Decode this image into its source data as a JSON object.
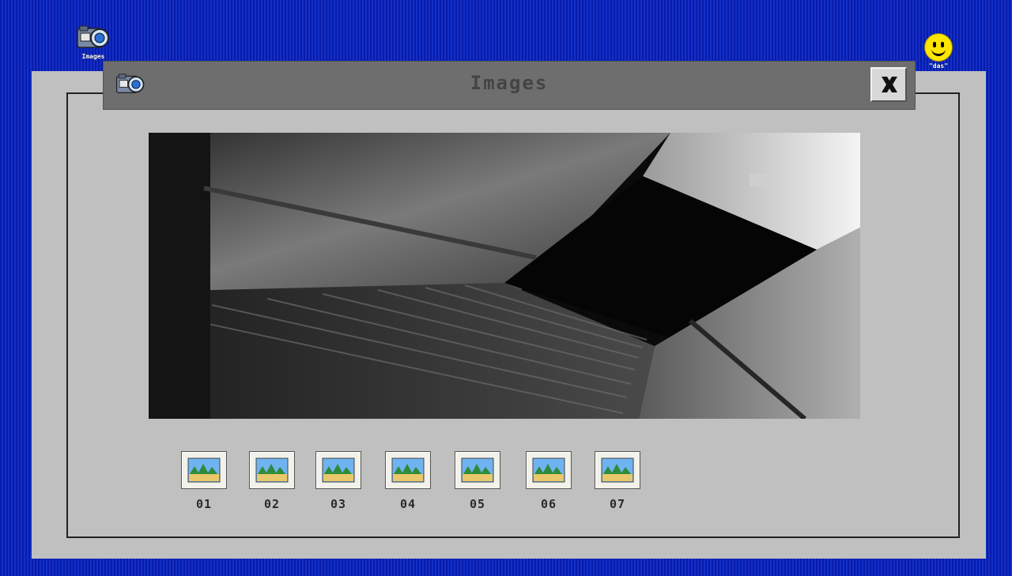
{
  "desktop": {
    "icons": [
      {
        "label": "Images",
        "icon": "camera-icon"
      },
      {
        "label": "\"das\"",
        "icon": "smiley-icon"
      }
    ]
  },
  "window": {
    "title": "Images",
    "close_icon": "close-icon",
    "viewer": {
      "subject": "grayscale staircase photo"
    },
    "thumbnails": [
      {
        "label": "01",
        "icon": "image-thumbnail-icon"
      },
      {
        "label": "02",
        "icon": "image-thumbnail-icon"
      },
      {
        "label": "03",
        "icon": "image-thumbnail-icon"
      },
      {
        "label": "04",
        "icon": "image-thumbnail-icon"
      },
      {
        "label": "05",
        "icon": "image-thumbnail-icon"
      },
      {
        "label": "06",
        "icon": "image-thumbnail-icon"
      },
      {
        "label": "07",
        "icon": "image-thumbnail-icon"
      }
    ]
  },
  "colors": {
    "desktop": "#0b1fb0",
    "window": "#c0c0c0",
    "titlebar": "#6e6e6e"
  }
}
